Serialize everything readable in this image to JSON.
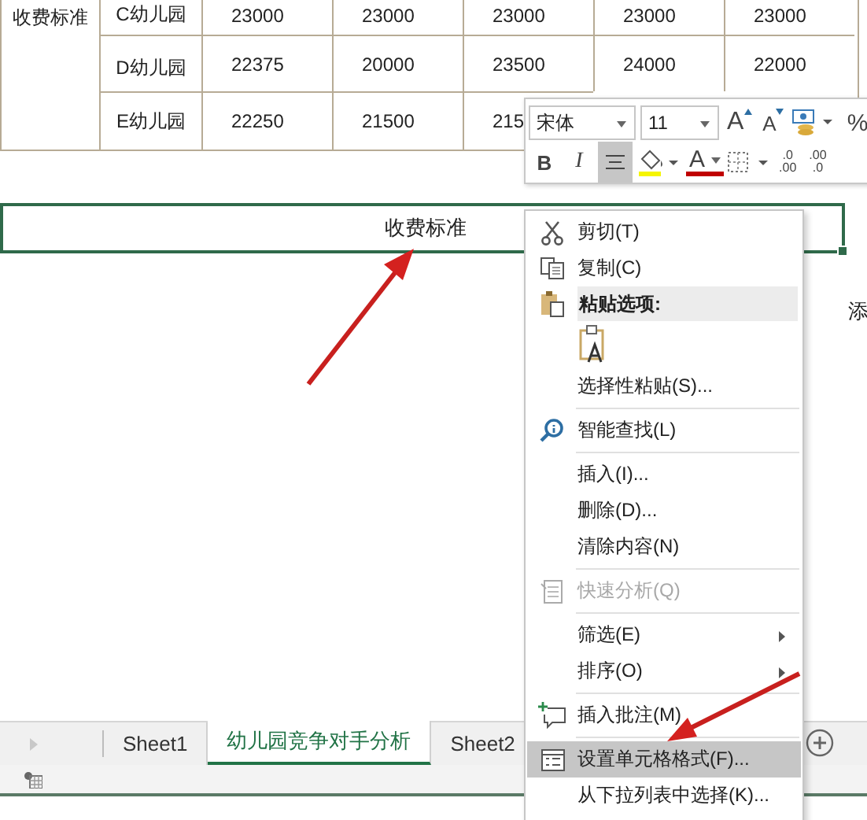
{
  "table": {
    "group_label": "收费标准",
    "rows": [
      {
        "name": "C幼儿园",
        "values": [
          "23000",
          "23000",
          "23000",
          "23000",
          "23000"
        ]
      },
      {
        "name": "D幼儿园",
        "values": [
          "22375",
          "20000",
          "23500",
          "24000",
          "22000"
        ]
      },
      {
        "name": "E幼儿园",
        "values": [
          "22250",
          "21500",
          "215"
        ]
      }
    ]
  },
  "selected_cell": {
    "text": "收费标准"
  },
  "edge_cell_text": "添",
  "mini_toolbar": {
    "font": "宋体",
    "size": "11",
    "row_1": [
      {
        "kind": "grow",
        "label": "A"
      },
      {
        "kind": "shrink",
        "label": "A"
      },
      {
        "kind": "accounting"
      },
      {
        "kind": "percent",
        "label": "%"
      }
    ],
    "row_2": [
      {
        "kind": "bold",
        "label": "B",
        "selected": false
      },
      {
        "kind": "italic",
        "label": "I",
        "selected": false
      },
      {
        "kind": "align",
        "selected": true
      },
      {
        "kind": "fill"
      },
      {
        "kind": "font_color",
        "label": "A"
      },
      {
        "kind": "borders"
      },
      {
        "kind": "dec_more",
        "label": ".0",
        "label_2": ".00"
      },
      {
        "kind": "dec_less",
        "label": ".00",
        "label_2": ".0"
      }
    ]
  },
  "context_menu": [
    {
      "kind": "item",
      "label": "剪切(T)",
      "selected": false,
      "disabled": false,
      "submenu": false
    },
    {
      "kind": "item",
      "label": "复制(C)",
      "selected": false,
      "disabled": false,
      "submenu": false
    },
    {
      "kind": "header",
      "label": "粘贴选项:"
    },
    {
      "kind": "paste_options"
    },
    {
      "kind": "item",
      "label": "选择性粘贴(S)...",
      "selected": false,
      "disabled": false,
      "submenu": false
    },
    {
      "kind": "separator"
    },
    {
      "kind": "item",
      "label": "智能查找(L)",
      "selected": false,
      "disabled": false,
      "submenu": false
    },
    {
      "kind": "separator"
    },
    {
      "kind": "item",
      "label": "插入(I)...",
      "selected": false,
      "disabled": false,
      "submenu": false
    },
    {
      "kind": "item",
      "label": "删除(D)...",
      "selected": false,
      "disabled": false,
      "submenu": false
    },
    {
      "kind": "item",
      "label": "清除内容(N)",
      "selected": false,
      "disabled": false,
      "submenu": false
    },
    {
      "kind": "separator"
    },
    {
      "kind": "item",
      "label": "快速分析(Q)",
      "selected": false,
      "disabled": true,
      "submenu": false
    },
    {
      "kind": "separator"
    },
    {
      "kind": "item",
      "label": "筛选(E)",
      "selected": false,
      "disabled": false,
      "submenu": true
    },
    {
      "kind": "item",
      "label": "排序(O)",
      "selected": false,
      "disabled": false,
      "submenu": true
    },
    {
      "kind": "separator"
    },
    {
      "kind": "item",
      "label": "插入批注(M)",
      "selected": false,
      "disabled": false,
      "submenu": false
    },
    {
      "kind": "separator"
    },
    {
      "kind": "item",
      "label": "设置单元格格式(F)...",
      "selected": true,
      "disabled": false,
      "submenu": false
    },
    {
      "kind": "item",
      "label": "从下拉列表中选择(K)...",
      "selected": false,
      "disabled": false,
      "submenu": false
    }
  ],
  "sheet_tabs": [
    {
      "label": "Sheet1",
      "selected": false
    },
    {
      "label": "幼儿园竞争对手分析",
      "selected": true
    },
    {
      "label": "Sheet2",
      "selected": false
    }
  ]
}
